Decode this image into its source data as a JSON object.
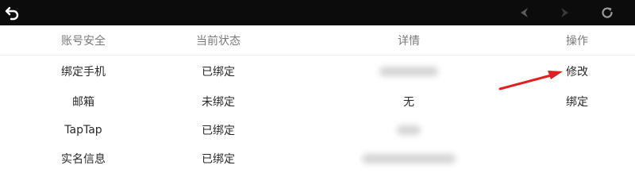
{
  "toolbar": {
    "back_icon": "back-arrow-icon",
    "prev_icon": "nav-left-icon",
    "next_icon": "nav-right-icon",
    "refresh_icon": "refresh-icon"
  },
  "table": {
    "headers": [
      "账号安全",
      "当前状态",
      "详情",
      "操作"
    ],
    "rows": [
      {
        "item": "绑定手机",
        "status": "已绑定",
        "detail": "",
        "action": "修改"
      },
      {
        "item": "邮箱",
        "status": "未绑定",
        "detail": "无",
        "action": "绑定"
      },
      {
        "item": "TapTap",
        "status": "已绑定",
        "detail": "",
        "action": ""
      },
      {
        "item": "实名信息",
        "status": "已绑定",
        "detail": "",
        "action": ""
      }
    ]
  },
  "colors": {
    "toolbar_bg": "#0c0c0c",
    "link": "#3b8fd6",
    "annotation_arrow": "#e02020"
  }
}
